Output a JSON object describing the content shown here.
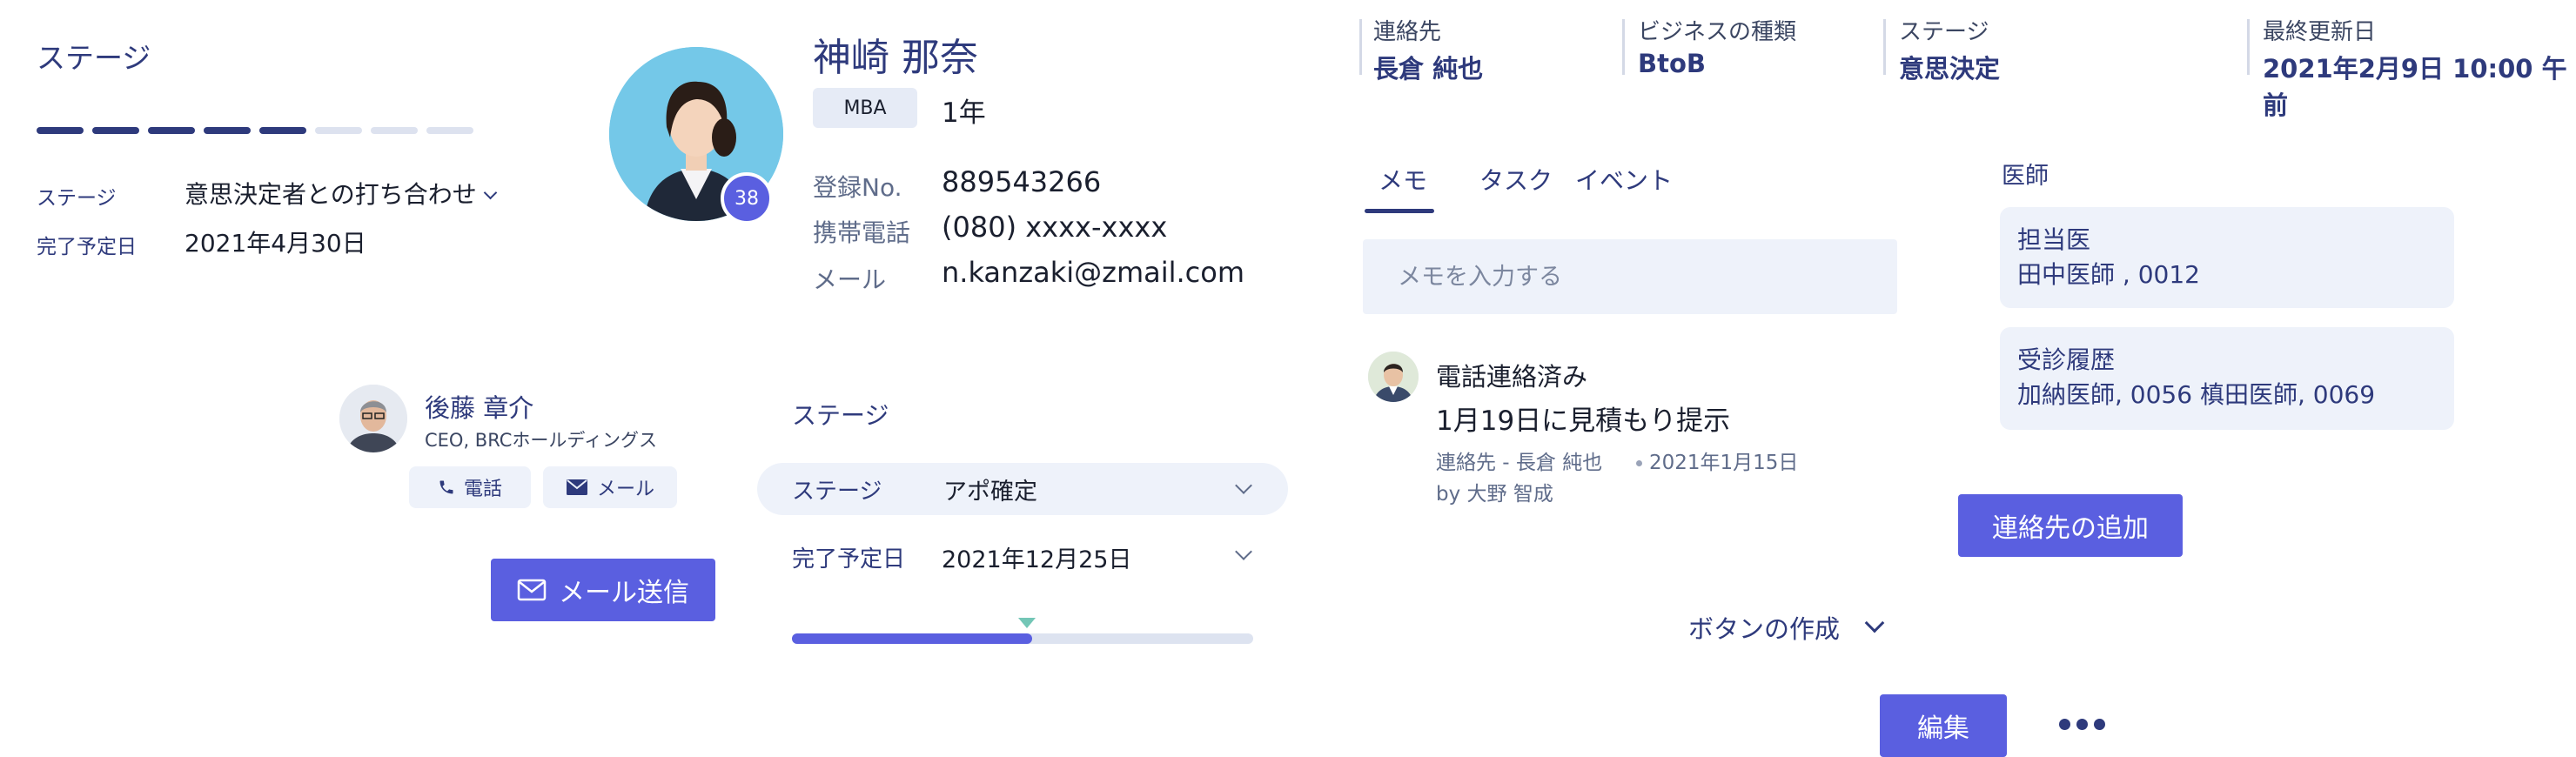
{
  "stage_panel": {
    "title": "ステージ",
    "progress": {
      "total_segments": 8,
      "completed_segments": 5
    },
    "stage_label": "ステージ",
    "stage_value": "意思決定者との打ち合わせ",
    "due_label": "完了予定日",
    "due_value": "2021年4月30日"
  },
  "profile": {
    "name": "神崎 那奈",
    "badge_count": "38",
    "degree_tag": "MBA",
    "years": "1年",
    "reg_label": "登録No.",
    "reg_value": "889543266",
    "phone_label": "携帯電話",
    "phone_value": "(080) xxxx-xxxx",
    "mail_label": "メール",
    "mail_value": "n.kanzaki@zmail.com"
  },
  "contact_person": {
    "name": "後藤 章介",
    "title": "CEO, BRCホールディングス",
    "call_label": "電話",
    "mail_label": "メール",
    "send_mail_label": "メール送信"
  },
  "mid_stage": {
    "title": "ステージ",
    "stage_label": "ステージ",
    "stage_value": "アポ確定",
    "due_label": "完了予定日",
    "due_value": "2021年12月25日",
    "progress_fraction": 0.52
  },
  "header": {
    "contact_label": "連絡先",
    "contact_value": "長倉 純也",
    "biz_label": "ビジネスの種類",
    "biz_value": "BtoB",
    "stage_label": "ステージ",
    "stage_value": "意思決定",
    "updated_label": "最終更新日",
    "updated_value": "2021年2月9日 10:00 午前"
  },
  "tabs": [
    {
      "label": "メモ",
      "active": true
    },
    {
      "label": "タスク",
      "active": false
    },
    {
      "label": "イベント",
      "active": false
    }
  ],
  "memo": {
    "placeholder": "メモを入力する"
  },
  "activity": {
    "title": "電話連絡済み",
    "text": "1月19日に見積もり提示",
    "contact": "連絡先 - 長倉 純也",
    "date": "2021年1月15日",
    "by": "by 大野 智成"
  },
  "doctors": {
    "title": "医師",
    "card1_label": "担当医",
    "card1_value": "田中医師 , 0012",
    "card2_label": "受診履歴",
    "card2_value": "加納医師, 0056 槙田医師, 0069",
    "add_contact_label": "連絡先の追加"
  },
  "actions": {
    "create_button_label": "ボタンの作成",
    "edit_label": "編集"
  },
  "colors": {
    "accent": "#5a5fe0",
    "navy": "#2e3a7c",
    "panel_bg": "#eef2fa",
    "progress_marker": "#73c6b6"
  }
}
